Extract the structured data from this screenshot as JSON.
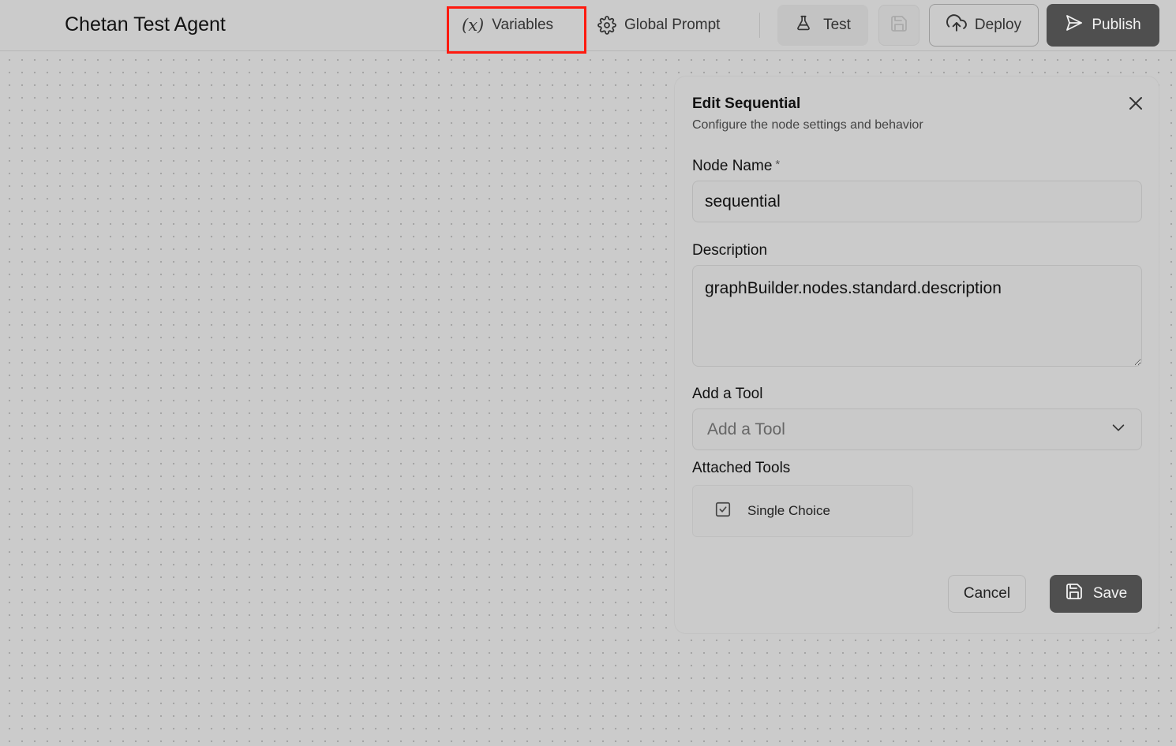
{
  "header": {
    "title": "Chetan Test Agent",
    "variables_label": "Variables",
    "global_prompt_label": "Global Prompt",
    "test_label": "Test",
    "deploy_label": "Deploy",
    "publish_label": "Publish"
  },
  "panel": {
    "title": "Edit Sequential",
    "subtitle": "Configure the node settings and behavior",
    "node_name_label": "Node Name",
    "required_marker": "*",
    "node_name_value": "sequential",
    "description_label": "Description",
    "description_value": "graphBuilder.nodes.standard.description",
    "add_tool_label": "Add a Tool",
    "add_tool_placeholder": "Add a Tool",
    "attached_tools_label": "Attached Tools",
    "attached_tools": [
      {
        "name": "Single Choice",
        "icon": "checkbox-icon"
      }
    ],
    "cancel_label": "Cancel",
    "save_label": "Save"
  },
  "icons": {
    "variables": "function-x-icon",
    "global_prompt": "gear-icon",
    "test": "flask-icon",
    "save_toolbar": "floppy-disk-icon",
    "deploy": "cloud-upload-icon",
    "publish": "send-icon",
    "close": "close-icon",
    "select_chevron": "chevron-down-icon"
  },
  "colors": {
    "highlight": "#ff1a0f",
    "primary_button": "#4f4f4f"
  }
}
